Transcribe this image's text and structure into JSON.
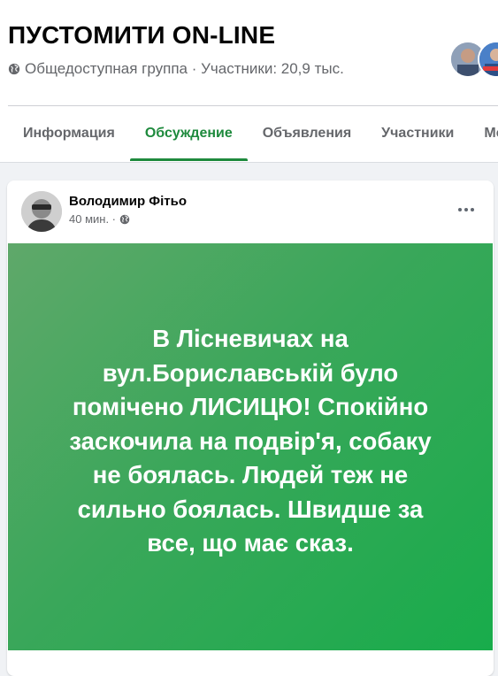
{
  "group": {
    "title": "ПУСТОМИТИ ON-LINE",
    "meta": "Общедоступная группа · Участники: 20,9 тыс.",
    "privacy_icon": "globe-icon"
  },
  "tabs": [
    {
      "label": "Информация",
      "active": false
    },
    {
      "label": "Обсуждение",
      "active": true
    },
    {
      "label": "Объявления",
      "active": false
    },
    {
      "label": "Участники",
      "active": false
    },
    {
      "label": "Ме",
      "active": false
    }
  ],
  "post": {
    "author": "Володимир Фітьо",
    "time": "40 мин. ·",
    "audience_icon": "globe-icon",
    "more_icon": "more-horizontal-icon",
    "text": "В Лісневичах на вул.Бориславській було помічено ЛИСИЦЮ! Спокійно заскочила на подвір'я, собаку не боялась. Людей теж не сильно боялась. Швидше за все, що має сказ."
  },
  "colors": {
    "accent": "#1e8a3d",
    "post_background_start": "#5fa86a",
    "post_background_end": "#18ac4b",
    "secondary_text": "#65676b"
  }
}
